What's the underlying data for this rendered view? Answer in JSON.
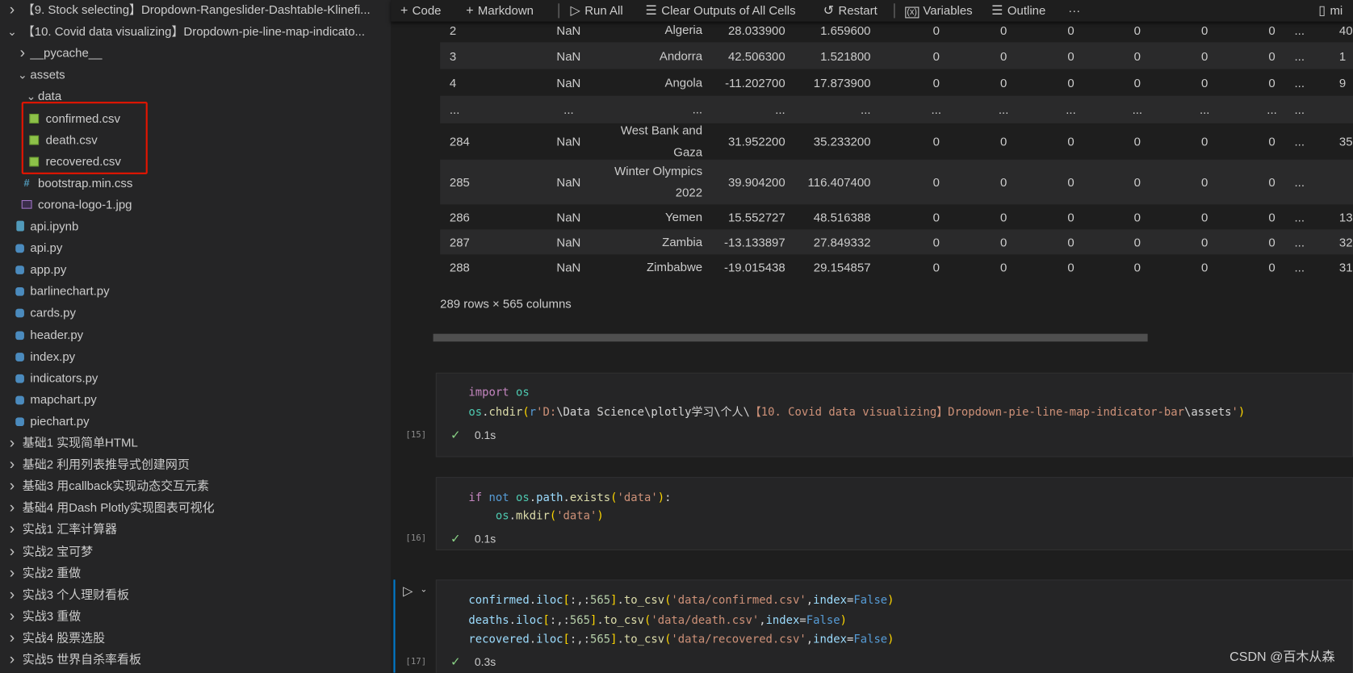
{
  "explorer": {
    "items": [
      {
        "label": "【9. Stock selecting】Dropdown-Rangeslider-Dashtable-Klinefi...",
        "level": 0,
        "type": "folder",
        "expanded": false
      },
      {
        "label": "【10. Covid data visualizing】Dropdown-pie-line-map-indicato...",
        "level": 0,
        "type": "folder",
        "expanded": true
      },
      {
        "label": "__pycache__",
        "level": 1,
        "type": "folder",
        "expanded": false
      },
      {
        "label": "assets",
        "level": 1,
        "type": "folder",
        "expanded": true
      },
      {
        "label": "data",
        "level": 2,
        "type": "folder",
        "expanded": true
      },
      {
        "label": "confirmed.csv",
        "level": 3,
        "type": "csv"
      },
      {
        "label": "death.csv",
        "level": 3,
        "type": "csv"
      },
      {
        "label": "recovered.csv",
        "level": 3,
        "type": "csv"
      },
      {
        "label": "bootstrap.min.css",
        "level": 2,
        "type": "css"
      },
      {
        "label": "corona-logo-1.jpg",
        "level": 2,
        "type": "image"
      },
      {
        "label": "api.ipynb",
        "level": 1,
        "type": "notebook"
      },
      {
        "label": "api.py",
        "level": 1,
        "type": "python"
      },
      {
        "label": "app.py",
        "level": 1,
        "type": "python"
      },
      {
        "label": "barlinechart.py",
        "level": 1,
        "type": "python"
      },
      {
        "label": "cards.py",
        "level": 1,
        "type": "python"
      },
      {
        "label": "header.py",
        "level": 1,
        "type": "python"
      },
      {
        "label": "index.py",
        "level": 1,
        "type": "python"
      },
      {
        "label": "indicators.py",
        "level": 1,
        "type": "python"
      },
      {
        "label": "mapchart.py",
        "level": 1,
        "type": "python"
      },
      {
        "label": "piechart.py",
        "level": 1,
        "type": "python"
      },
      {
        "label": "基础1 实现简单HTML",
        "level": 0,
        "type": "folder",
        "expanded": false
      },
      {
        "label": "基础2 利用列表推导式创建网页",
        "level": 0,
        "type": "folder",
        "expanded": false
      },
      {
        "label": "基础3  用callback实现动态交互元素",
        "level": 0,
        "type": "folder",
        "expanded": false
      },
      {
        "label": "基础4  用Dash Plotly实现图表可视化",
        "level": 0,
        "type": "folder",
        "expanded": false
      },
      {
        "label": "实战1 汇率计算器",
        "level": 0,
        "type": "folder",
        "expanded": false
      },
      {
        "label": "实战2 宝可梦",
        "level": 0,
        "type": "folder",
        "expanded": false
      },
      {
        "label": "实战2 重做",
        "level": 0,
        "type": "folder",
        "expanded": false
      },
      {
        "label": "实战3 个人理财看板",
        "level": 0,
        "type": "folder",
        "expanded": false
      },
      {
        "label": "实战3 重做",
        "level": 0,
        "type": "folder",
        "expanded": false
      },
      {
        "label": "实战4 股票选股",
        "level": 0,
        "type": "folder",
        "expanded": false
      },
      {
        "label": "实战5 世界自杀率看板",
        "level": 0,
        "type": "folder",
        "expanded": false
      }
    ]
  },
  "toolbar": {
    "code": "Code",
    "markdown": "Markdown",
    "run_all": "Run All",
    "clear_outputs": "Clear Outputs of All Cells",
    "restart": "Restart",
    "variables": "Variables",
    "outline": "Outline",
    "more": "···",
    "kernel": "mi"
  },
  "table": {
    "rows": [
      [
        "2",
        "NaN",
        "Algeria",
        "28.033900",
        "1.659600",
        "0",
        "0",
        "0",
        "0",
        "0",
        "0",
        "...",
        "40"
      ],
      [
        "3",
        "NaN",
        "Andorra",
        "42.506300",
        "1.521800",
        "0",
        "0",
        "0",
        "0",
        "0",
        "0",
        "...",
        "1"
      ],
      [
        "4",
        "NaN",
        "Angola",
        "-11.202700",
        "17.873900",
        "0",
        "0",
        "0",
        "0",
        "0",
        "0",
        "...",
        "9"
      ],
      [
        "...",
        "...",
        "...",
        "...",
        "...",
        "...",
        "...",
        "...",
        "...",
        "...",
        "...",
        "...",
        ""
      ],
      [
        "284",
        "NaN",
        "West Bank and Gaza",
        "31.952200",
        "35.233200",
        "0",
        "0",
        "0",
        "0",
        "0",
        "0",
        "...",
        "35"
      ],
      [
        "285",
        "NaN",
        "Winter Olympics 2022",
        "39.904200",
        "116.407400",
        "0",
        "0",
        "0",
        "0",
        "0",
        "0",
        "...",
        ""
      ],
      [
        "286",
        "NaN",
        "Yemen",
        "15.552727",
        "48.516388",
        "0",
        "0",
        "0",
        "0",
        "0",
        "0",
        "...",
        "13"
      ],
      [
        "287",
        "NaN",
        "Zambia",
        "-13.133897",
        "27.849332",
        "0",
        "0",
        "0",
        "0",
        "0",
        "0",
        "...",
        "32"
      ],
      [
        "288",
        "NaN",
        "Zimbabwe",
        "-19.015438",
        "29.154857",
        "0",
        "0",
        "0",
        "0",
        "0",
        "0",
        "...",
        "31"
      ]
    ],
    "shape": "289 rows × 565 columns"
  },
  "cells": [
    {
      "count": "[15]",
      "time": "0.1s",
      "lines": [
        [
          [
            "import",
            "kw"
          ],
          [
            " ",
            "pl"
          ],
          [
            "os",
            "cls"
          ]
        ],
        [
          [
            "os",
            "cls"
          ],
          [
            ".",
            "pl"
          ],
          [
            "chdir",
            "fn"
          ],
          [
            "(",
            "b1"
          ],
          [
            "r",
            "kb"
          ],
          [
            "'D:",
            "str"
          ],
          [
            "\\Data Science\\plotly学习\\个人\\",
            "pl"
          ],
          [
            "【10. Covid data visualizing】Dropdown-pie-line-map-indicator-bar",
            "str"
          ],
          [
            "\\assets",
            "pl"
          ],
          [
            "'",
            "str"
          ],
          [
            ")",
            "b1"
          ]
        ]
      ]
    },
    {
      "count": "[16]",
      "time": "0.1s",
      "lines": [
        [
          [
            "if",
            "kw"
          ],
          [
            " ",
            "pl"
          ],
          [
            "not",
            "kb"
          ],
          [
            " ",
            "pl"
          ],
          [
            "os",
            "cls"
          ],
          [
            ".",
            "pl"
          ],
          [
            "path",
            "var"
          ],
          [
            ".",
            "pl"
          ],
          [
            "exists",
            "fn"
          ],
          [
            "(",
            "b1"
          ],
          [
            "'data'",
            "str"
          ],
          [
            ")",
            "b1"
          ],
          [
            ":",
            "pl"
          ]
        ],
        [
          [
            "    ",
            "pl"
          ],
          [
            "os",
            "cls"
          ],
          [
            ".",
            "pl"
          ],
          [
            "mkdir",
            "fn"
          ],
          [
            "(",
            "b1"
          ],
          [
            "'data'",
            "str"
          ],
          [
            ")",
            "b1"
          ]
        ]
      ]
    },
    {
      "count": "[17]",
      "time": "0.3s",
      "lines": [
        [
          [
            "confirmed",
            "var"
          ],
          [
            ".",
            "pl"
          ],
          [
            "iloc",
            "var"
          ],
          [
            "[",
            "b1"
          ],
          [
            ":,:",
            "pl"
          ],
          [
            "565",
            "num"
          ],
          [
            "]",
            "b1"
          ],
          [
            ".",
            "pl"
          ],
          [
            "to_csv",
            "fn"
          ],
          [
            "(",
            "b1"
          ],
          [
            "'data/confirmed.csv'",
            "str"
          ],
          [
            ",",
            "pl"
          ],
          [
            "index",
            "var"
          ],
          [
            "=",
            "pl"
          ],
          [
            "False",
            "kb"
          ],
          [
            ")",
            "b1"
          ]
        ],
        [
          [
            "deaths",
            "var"
          ],
          [
            ".",
            "pl"
          ],
          [
            "iloc",
            "var"
          ],
          [
            "[",
            "b1"
          ],
          [
            ":,:",
            "pl"
          ],
          [
            "565",
            "num"
          ],
          [
            "]",
            "b1"
          ],
          [
            ".",
            "pl"
          ],
          [
            "to_csv",
            "fn"
          ],
          [
            "(",
            "b1"
          ],
          [
            "'data/death.csv'",
            "str"
          ],
          [
            ",",
            "pl"
          ],
          [
            "index",
            "var"
          ],
          [
            "=",
            "pl"
          ],
          [
            "False",
            "kb"
          ],
          [
            ")",
            "b1"
          ]
        ],
        [
          [
            "recovered",
            "var"
          ],
          [
            ".",
            "pl"
          ],
          [
            "iloc",
            "var"
          ],
          [
            "[",
            "b1"
          ],
          [
            ":,:",
            "pl"
          ],
          [
            "565",
            "num"
          ],
          [
            "]",
            "b1"
          ],
          [
            ".",
            "pl"
          ],
          [
            "to_csv",
            "fn"
          ],
          [
            "(",
            "b1"
          ],
          [
            "'data/recovered.csv'",
            "str"
          ],
          [
            ",",
            "pl"
          ],
          [
            "index",
            "var"
          ],
          [
            "=",
            "pl"
          ],
          [
            "False",
            "kb"
          ],
          [
            ")",
            "b1"
          ]
        ]
      ]
    }
  ],
  "watermark": "CSDN @百木从森",
  "colors": {
    "highlight_box": "#e51400",
    "success": "#89d185",
    "csv_icon": "#8dc149"
  }
}
